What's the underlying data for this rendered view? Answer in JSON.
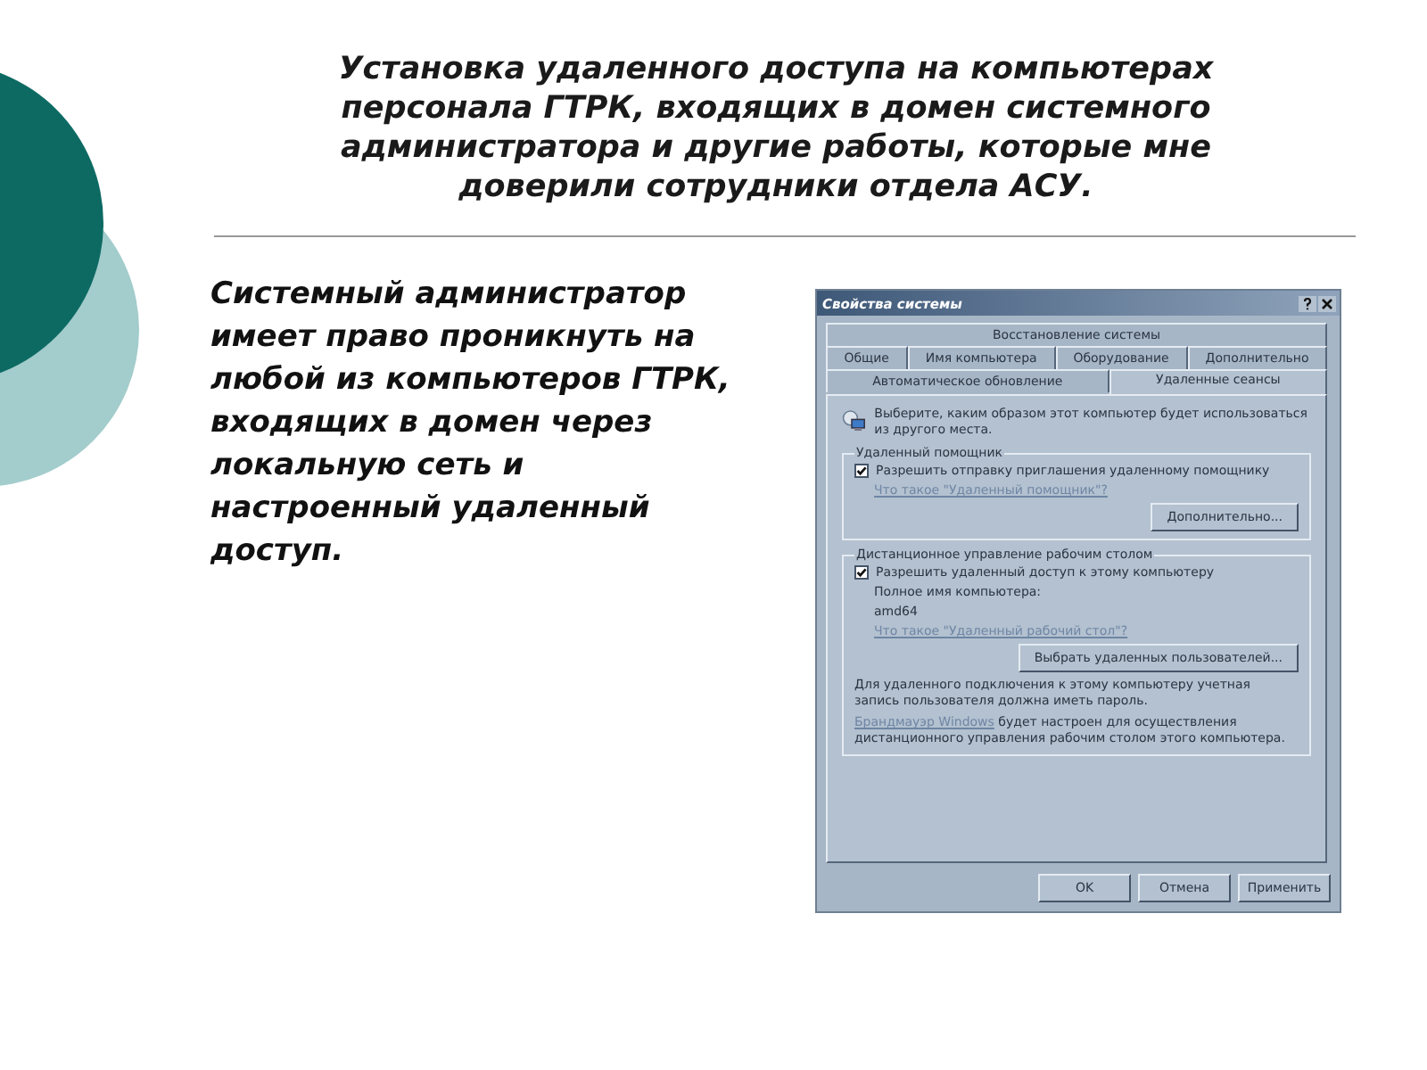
{
  "slide": {
    "title": "Установка удаленного доступа на компьютерах персонала ГТРК, входящих в домен системного администратора и другие работы, которые мне доверили сотрудники отдела АСУ.",
    "body": "Системный администратор имеет право проникнуть на любой из компьютеров ГТРК, входящих в домен через локальную сеть и настроенный удаленный доступ."
  },
  "dialog": {
    "title": "Свойства системы",
    "tab_rows": [
      [
        {
          "label": "Восстановление системы",
          "selected": false
        }
      ],
      [
        {
          "label": "Общие",
          "selected": false
        },
        {
          "label": "Имя компьютера",
          "selected": false
        },
        {
          "label": "Оборудование",
          "selected": false
        },
        {
          "label": "Дополнительно",
          "selected": false
        }
      ],
      [
        {
          "label": "Автоматическое обновление",
          "selected": false
        },
        {
          "label": "Удаленные сеансы",
          "selected": true
        }
      ]
    ],
    "intro": "Выберите, каким образом этот компьютер будет использоваться из другого места.",
    "assistance": {
      "legend": "Удаленный помощник",
      "checkbox": {
        "label": "Разрешить отправку приглашения удаленному помощнику",
        "checked": true
      },
      "link": "Что такое \"Удаленный помощник\"?",
      "button": "Дополнительно..."
    },
    "desktop": {
      "legend": "Дистанционное управление рабочим столом",
      "checkbox": {
        "label": "Разрешить удаленный доступ к этому компьютеру",
        "checked": true
      },
      "name_label": "Полное имя компьютера:",
      "name_value": "amd64",
      "link": "Что такое \"Удаленный рабочий стол\"?",
      "button": "Выбрать удаленных пользователей...",
      "note": "Для удаленного подключения к этому компьютеру учетная запись пользователя должна иметь пароль.",
      "firewall_link": "Брандмауэр Windows",
      "firewall_text": "будет настроен для осуществления дистанционного управления рабочим столом этого компьютера."
    },
    "buttons": [
      "OK",
      "Отмена",
      "Применить"
    ]
  }
}
